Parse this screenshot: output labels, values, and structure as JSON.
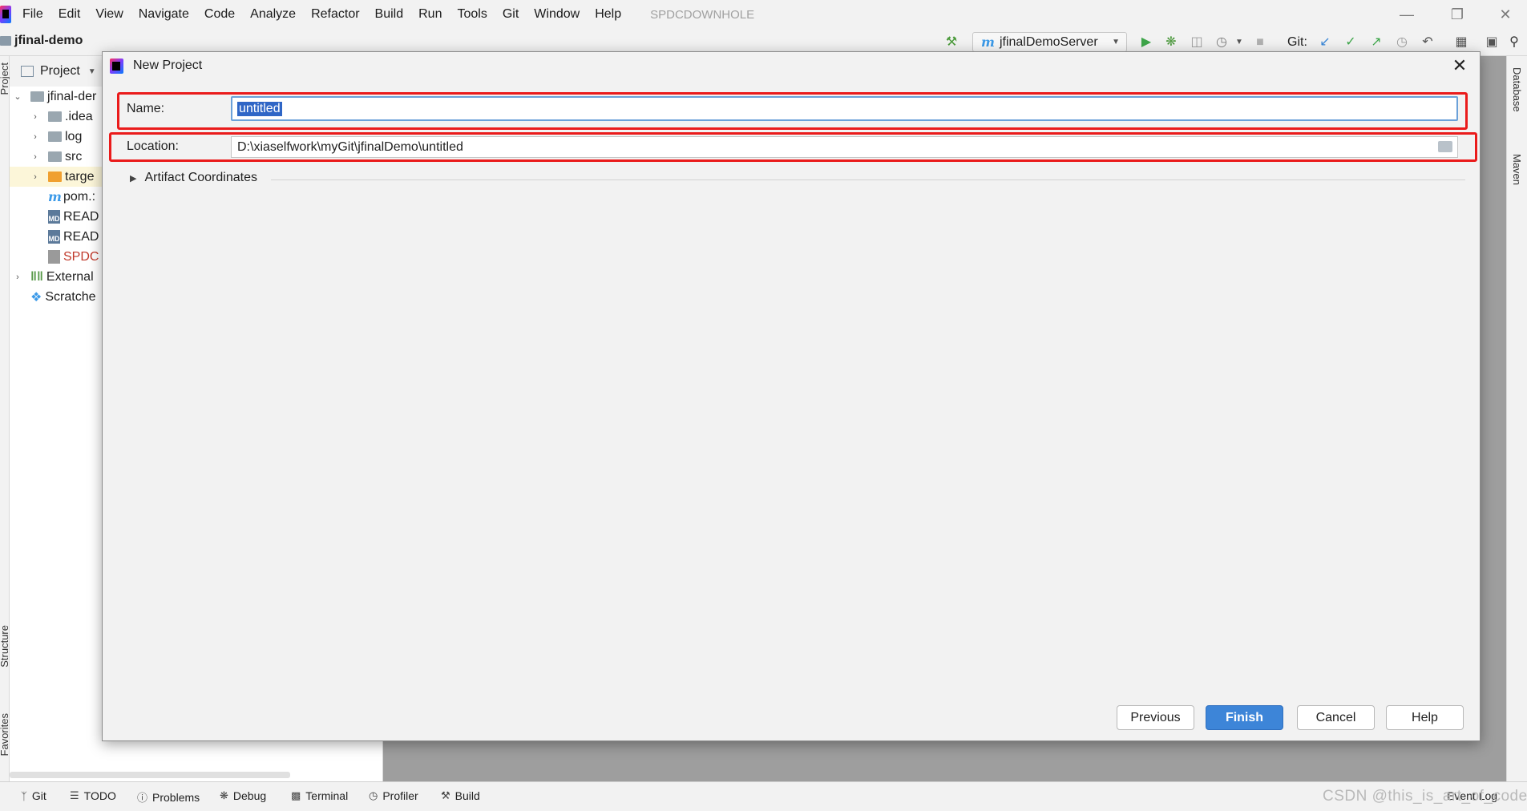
{
  "menubar": {
    "items": [
      "File",
      "Edit",
      "View",
      "Navigate",
      "Code",
      "Analyze",
      "Refactor",
      "Build",
      "Run",
      "Tools",
      "Git",
      "Window",
      "Help"
    ],
    "project_title": "SPDCDOWNHOLE"
  },
  "navbar": {
    "breadcrumb": "jfinal-demo",
    "run_config": "jfinalDemoServer",
    "git_label": "Git:"
  },
  "left_strip": {
    "project": "Project",
    "structure": "Structure",
    "favorites": "Favorites"
  },
  "right_strip": {
    "database": "Database",
    "maven": "Maven"
  },
  "project_panel": {
    "title": "Project",
    "tree": [
      {
        "label": "jfinal-der",
        "kind": "module"
      },
      {
        "label": ".idea",
        "kind": "folder"
      },
      {
        "label": "log",
        "kind": "folder"
      },
      {
        "label": "src",
        "kind": "folder"
      },
      {
        "label": "targe",
        "kind": "folder-orange"
      },
      {
        "label": "pom.:",
        "kind": "maven"
      },
      {
        "label": "READ",
        "kind": "md"
      },
      {
        "label": "READ",
        "kind": "md"
      },
      {
        "label": "SPDC",
        "kind": "file-red"
      },
      {
        "label": "External",
        "kind": "libraries"
      },
      {
        "label": "Scratche",
        "kind": "scratches"
      }
    ]
  },
  "bottom_bar": {
    "tabs": [
      "Git",
      "TODO",
      "Problems",
      "Debug",
      "Terminal",
      "Profiler",
      "Build"
    ],
    "event_log": "Event Log",
    "watermark": "CSDN @this_is_art_of_code"
  },
  "dialog": {
    "title": "New Project",
    "name_label": "Name:",
    "name_value": "untitled",
    "location_label": "Location:",
    "location_value": "D:\\xiaselfwork\\myGit\\jfinalDemo\\untitled",
    "artifact_label": "Artifact Coordinates",
    "buttons": {
      "previous": "Previous",
      "finish": "Finish",
      "cancel": "Cancel",
      "help": "Help"
    }
  },
  "colors": {
    "highlight_box": "#ea1b1b",
    "primary_button": "#3d85d8",
    "selection": "#2f66c6"
  }
}
